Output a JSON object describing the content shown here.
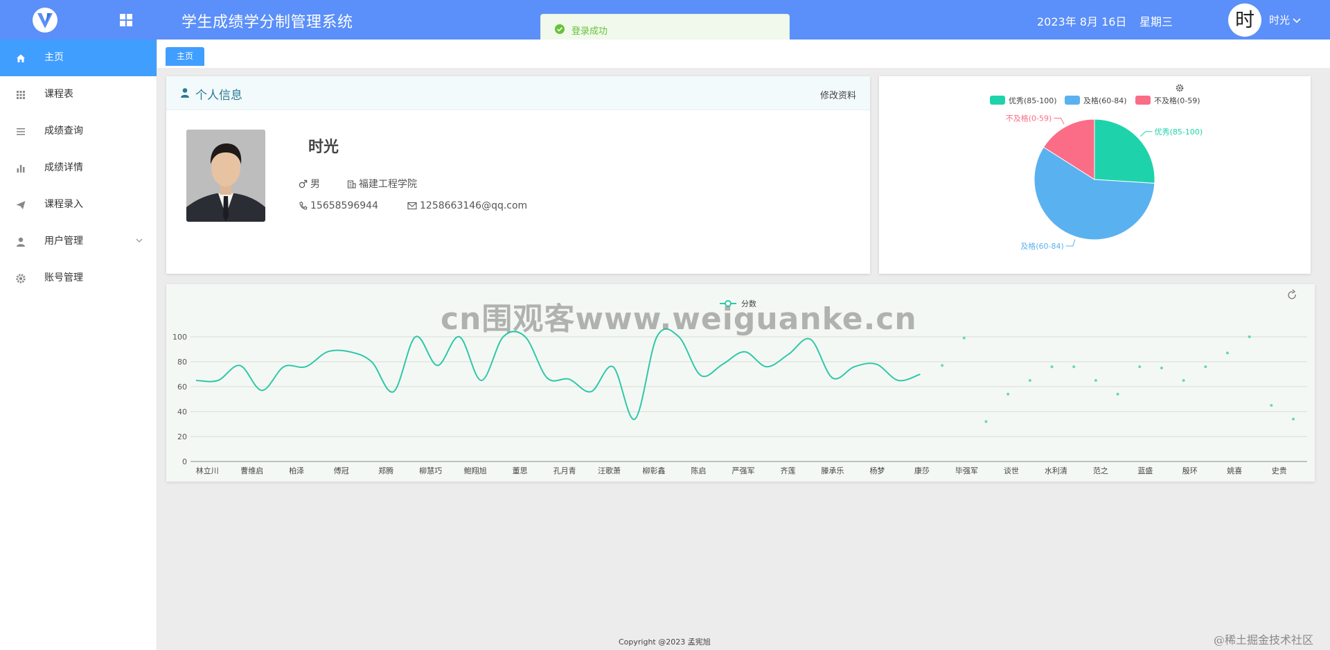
{
  "header": {
    "title": "学生成绩学分制管理系统",
    "date": "2023年 8月 16日",
    "weekday": "星期三",
    "avatar_char": "时",
    "username": "时光"
  },
  "toast": {
    "message": "登录成功",
    "color": "#67c23a"
  },
  "sidebar": {
    "items": [
      {
        "label": "主页",
        "icon": "home-icon",
        "active": true
      },
      {
        "label": "课程表",
        "icon": "grid-icon"
      },
      {
        "label": "成绩查询",
        "icon": "list-icon"
      },
      {
        "label": "成绩详情",
        "icon": "bar-chart-icon"
      },
      {
        "label": "课程录入",
        "icon": "send-icon"
      },
      {
        "label": "用户管理",
        "icon": "user-icon",
        "expandable": true
      },
      {
        "label": "账号管理",
        "icon": "gear-icon"
      }
    ]
  },
  "tabs": [
    {
      "label": "主页"
    }
  ],
  "profile": {
    "header_title": "个人信息",
    "edit_label": "修改资料",
    "name": "时光",
    "gender": "男",
    "school": "福建工程学院",
    "phone": "15658596944",
    "email": "1258663146@qq.com"
  },
  "chart_data": [
    {
      "type": "pie",
      "legend_position": "top",
      "labels": [
        "优秀(85-100)",
        "及格(60-84)",
        "不及格(0-59)"
      ],
      "values": [
        26,
        58,
        16
      ],
      "colors": [
        "#1ed3ab",
        "#5ab1ef",
        "#fb6c86"
      ]
    },
    {
      "type": "line",
      "legend": [
        "分数"
      ],
      "color": "#2ec7a9",
      "ylim": [
        0,
        100
      ],
      "yticks": [
        0,
        20,
        40,
        60,
        80,
        100
      ],
      "categories": [
        "林立川",
        "曹维启",
        "柏泽",
        "傅冠",
        "郑腾",
        "柳慧巧",
        "鲍翔旭",
        "董思",
        "孔月青",
        "汪歌萧",
        "柳彰鑫",
        "陈启",
        "严强军",
        "齐莲",
        "滕承乐",
        "杨梦",
        "康莎",
        "毕强军",
        "谈世",
        "水利清",
        "范之",
        "蓝盛",
        "殷环",
        "姚喜",
        "史贵"
      ],
      "values": [
        65,
        65,
        77,
        57,
        76,
        76,
        88,
        88,
        80,
        56,
        100,
        77,
        100,
        65,
        100,
        100,
        67,
        66,
        56,
        76,
        34,
        100,
        100,
        69,
        78,
        88,
        76,
        86,
        98,
        67,
        76,
        78,
        65,
        70,
        77,
        99,
        32,
        54,
        65,
        76,
        76,
        65,
        54,
        76,
        75,
        65,
        76,
        87,
        100,
        45,
        34
      ],
      "line_points": 34
    }
  ],
  "footer": "Copyright @2023 孟宪旭",
  "watermark": "cn围观客www.weiguanke.cn",
  "corner_watermark": "@稀土掘金技术社区"
}
